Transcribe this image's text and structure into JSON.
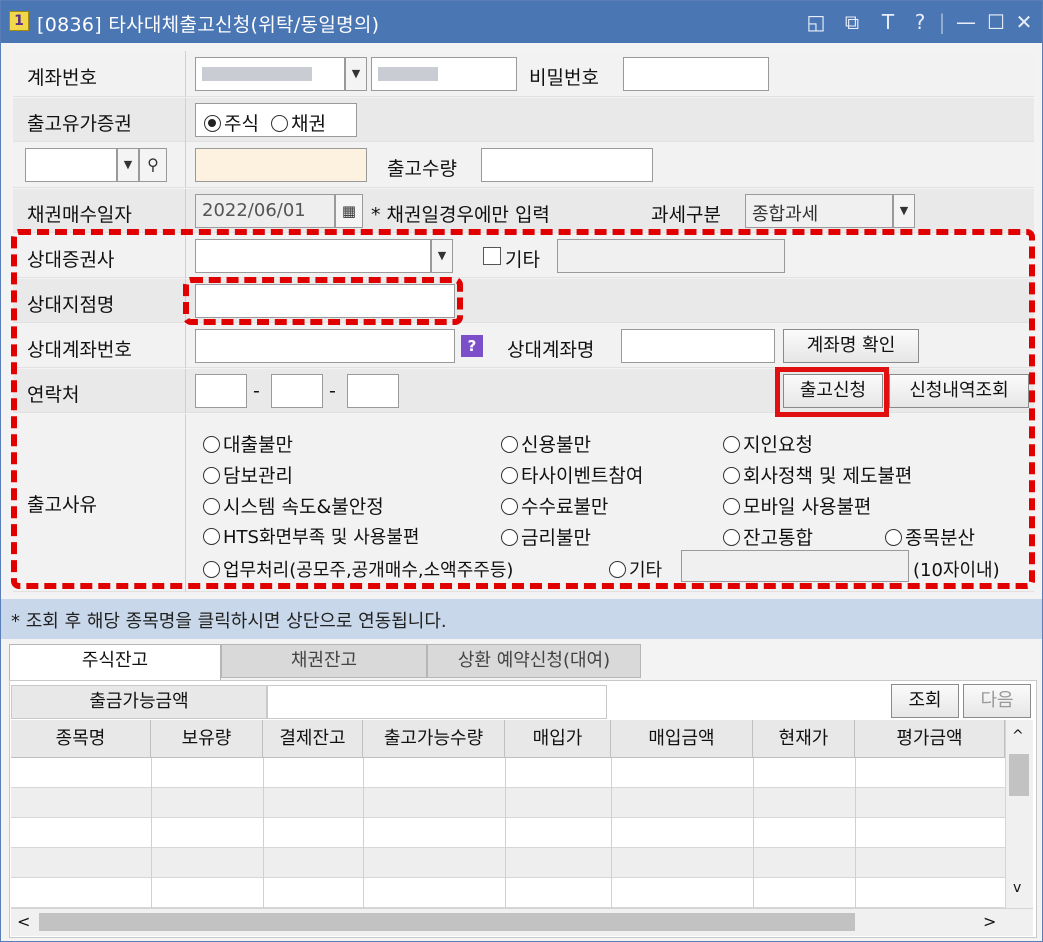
{
  "window": {
    "app_icon": "1",
    "title": "[0836] 타사대체출고신청(위탁/동일명의)",
    "controls": [
      "◱",
      "⧉",
      "T",
      "?",
      "|",
      "—",
      "☐",
      "✕"
    ]
  },
  "form": {
    "account_label": "계좌번호",
    "account_number": "",
    "account_name": "",
    "password_label": "비밀번호",
    "password_value": "",
    "security_type_label": "출고유가증권",
    "security_options": [
      "주식",
      "채권"
    ],
    "security_selected": "주식",
    "stock_code_value": "",
    "stock_name_value": "",
    "quantity_label": "출고수량",
    "quantity_value": "",
    "bond_date_label": "채권매수일자",
    "bond_date_value": "2022/06/01",
    "bond_note": "* 채권일경우에만 입력",
    "tax_label": "과세구분",
    "tax_value": "종합과세",
    "counter_firm_label": "상대증권사",
    "counter_firm_value": "",
    "other_label": "기타",
    "other_value": "",
    "counter_branch_label": "상대지점명",
    "counter_branch_value": "",
    "counter_account_label": "상대계좌번호",
    "counter_account_value": "",
    "counter_account_name_label": "상대계좌명",
    "counter_account_name_value": "",
    "check_name_button": "계좌명 확인",
    "contact_label": "연락처",
    "contact_sep": "-",
    "submit_button": "출고신청",
    "history_button": "신청내역조회",
    "reason_label": "출고사유",
    "reasons": [
      "대출불만",
      "신용불만",
      "지인요청",
      "담보관리",
      "타사이벤트참여",
      "회사정책 및 제도불편",
      "시스템 속도&불안정",
      "수수료불만",
      "모바일 사용불편",
      "HTS화면부족 및 사용불편",
      "금리불만",
      "잔고통합",
      "종목분산",
      "업무처리(공모주,공개매수,소액주주등)",
      "기타"
    ],
    "reason_other_value": "",
    "reason_limit_note": "(10자이내)"
  },
  "info_bar": "* 조회 후 해당 종목명을 클릭하시면 상단으로 연동됩니다.",
  "tabs": [
    "주식잔고",
    "채권잔고",
    "상환 예약신청(대여)"
  ],
  "balance": {
    "available_label": "출금가능금액",
    "available_value": "",
    "query_button": "조회",
    "next_button": "다음"
  },
  "table": {
    "columns": [
      "종목명",
      "보유량",
      "결제잔고",
      "출고가능수량",
      "매입가",
      "매입금액",
      "현재가",
      "평가금액"
    ],
    "rows": []
  },
  "scroll": {
    "up": "^",
    "down": "v",
    "left": "<",
    "right": ">"
  },
  "colors": {
    "titlebar": "#4a76b4",
    "highlight": "#e00000",
    "info_bar": "#c8d7ea"
  }
}
